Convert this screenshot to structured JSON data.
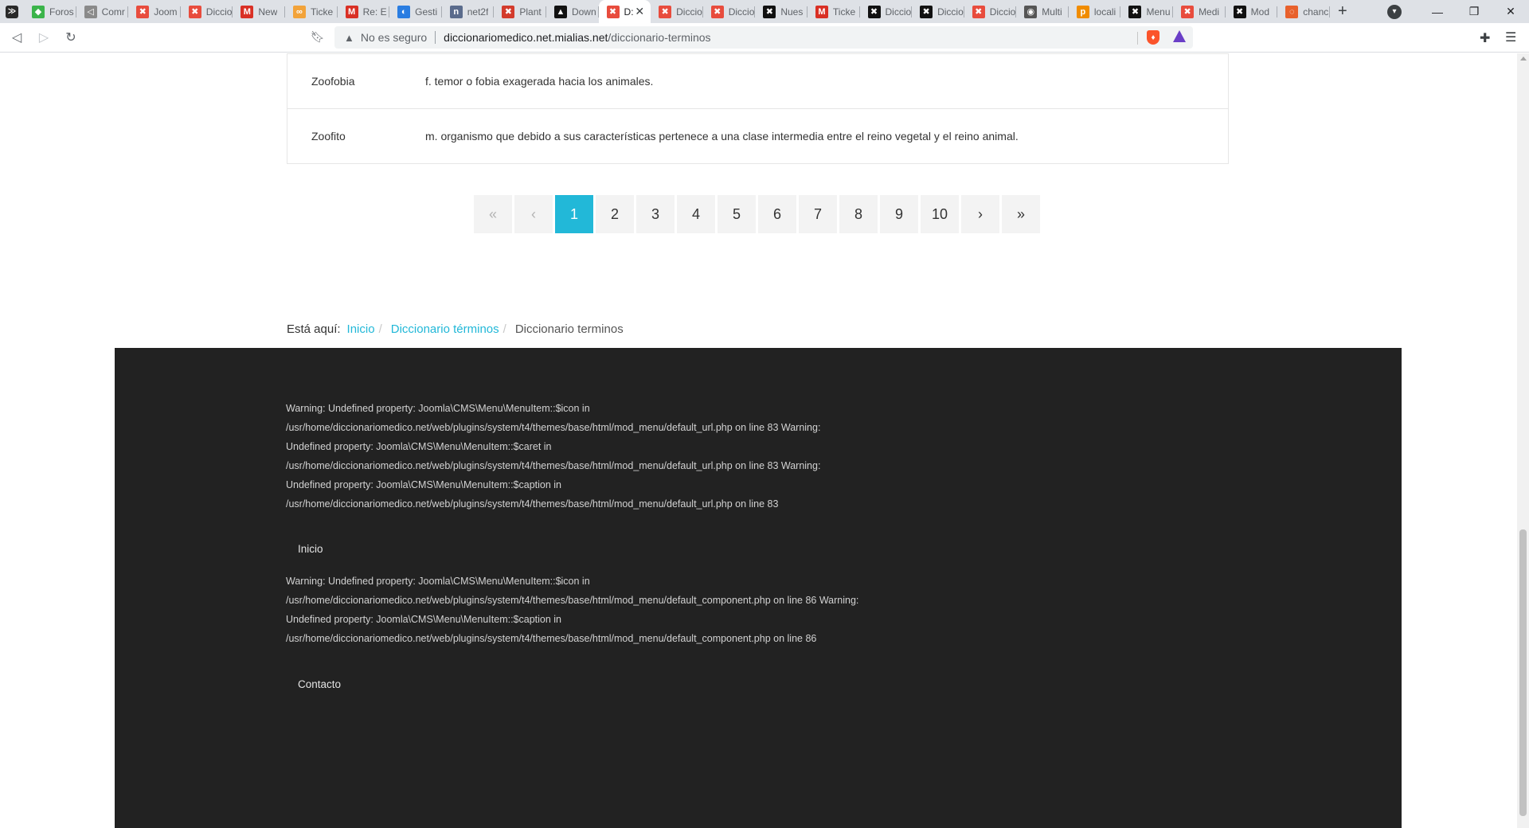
{
  "browser": {
    "tabs": [
      {
        "title": "Foros",
        "color": "#3bb44a",
        "glyph": "◆"
      },
      {
        "title": "Comr",
        "color": "#8a8a8a",
        "glyph": "◁"
      },
      {
        "title": "Joom",
        "color": "#e84c3d",
        "glyph": "✖"
      },
      {
        "title": "Diccio",
        "color": "#e84c3d",
        "glyph": "✖"
      },
      {
        "title": "New",
        "color": "#d93025",
        "glyph": "M"
      },
      {
        "title": "Ticke",
        "color": "#f2a33a",
        "glyph": "∞"
      },
      {
        "title": "Re: E",
        "color": "#d93025",
        "glyph": "M"
      },
      {
        "title": "Gesti",
        "color": "#2a7de1",
        "glyph": "◐"
      },
      {
        "title": "net2f",
        "color": "#5a6b8c",
        "glyph": "n"
      },
      {
        "title": "Plant",
        "color": "#d33b2c",
        "glyph": "✖"
      },
      {
        "title": "Down",
        "color": "#111111",
        "glyph": "▲"
      },
      {
        "title": "D:",
        "color": "#e84c3d",
        "glyph": "✖",
        "active": true
      },
      {
        "title": "Diccio",
        "color": "#e84c3d",
        "glyph": "✖"
      },
      {
        "title": "Diccio",
        "color": "#e84c3d",
        "glyph": "✖"
      },
      {
        "title": "Nues",
        "color": "#111111",
        "glyph": "✖"
      },
      {
        "title": "Ticke",
        "color": "#d93025",
        "glyph": "M"
      },
      {
        "title": "Diccio",
        "color": "#111111",
        "glyph": "✖"
      },
      {
        "title": "Diccio",
        "color": "#111111",
        "glyph": "✖"
      },
      {
        "title": "Diccio",
        "color": "#e84c3d",
        "glyph": "✖"
      },
      {
        "title": "Multi",
        "color": "#555555",
        "glyph": "◉"
      },
      {
        "title": "locali",
        "color": "#f08c00",
        "glyph": "p"
      },
      {
        "title": "Menu",
        "color": "#111111",
        "glyph": "✖"
      },
      {
        "title": "Medi",
        "color": "#e84c3d",
        "glyph": "✖"
      },
      {
        "title": "Mod",
        "color": "#111111",
        "glyph": "✖"
      },
      {
        "title": "chanc",
        "color": "#e8612c",
        "glyph": "◌"
      }
    ],
    "security_label": "No es seguro",
    "url_host": "diccionariomedico.net.mialias.net",
    "url_path": "/diccionario-terminos"
  },
  "terms": [
    {
      "word": "Zoofobia",
      "definition": "f. temor o fobia exagerada hacia los animales."
    },
    {
      "word": "Zoofito",
      "definition": "m. organismo que debido a sus características pertenece a una clase intermedia entre el reino vegetal y el reino animal."
    }
  ],
  "pagination": {
    "first": "«",
    "prev": "‹",
    "pages": [
      "1",
      "2",
      "3",
      "4",
      "5",
      "6",
      "7",
      "8",
      "9",
      "10"
    ],
    "active_page": "1",
    "next": "›",
    "last": "»"
  },
  "breadcrumb": {
    "lead": "Está aquí:",
    "items": [
      "Inicio",
      "Diccionario términos"
    ],
    "current": "Diccionario terminos"
  },
  "footer": {
    "warning_1": "Warning: Undefined property: Joomla\\CMS\\Menu\\MenuItem::$icon in /usr/home/diccionariomedico.net/web/plugins/system/t4/themes/base/html/mod_menu/default_url.php on line 83 Warning: Undefined property: Joomla\\CMS\\Menu\\MenuItem::$caret in /usr/home/diccionariomedico.net/web/plugins/system/t4/themes/base/html/mod_menu/default_url.php on line 83 Warning: Undefined property: Joomla\\CMS\\Menu\\MenuItem::$caption in /usr/home/diccionariomedico.net/web/plugins/system/t4/themes/base/html/mod_menu/default_url.php on line 83",
    "link_1": "Inicio",
    "warning_2": "Warning: Undefined property: Joomla\\CMS\\Menu\\MenuItem::$icon in /usr/home/diccionariomedico.net/web/plugins/system/t4/themes/base/html/mod_menu/default_component.php on line 86 Warning: Undefined property: Joomla\\CMS\\Menu\\MenuItem::$caption in /usr/home/diccionariomedico.net/web/plugins/system/t4/themes/base/html/mod_menu/default_component.php on line 86",
    "link_2": "Contacto"
  },
  "colors": {
    "accent": "#22b8d8",
    "footer_bg": "#222222",
    "pagination_bg": "#f3f3f3"
  }
}
